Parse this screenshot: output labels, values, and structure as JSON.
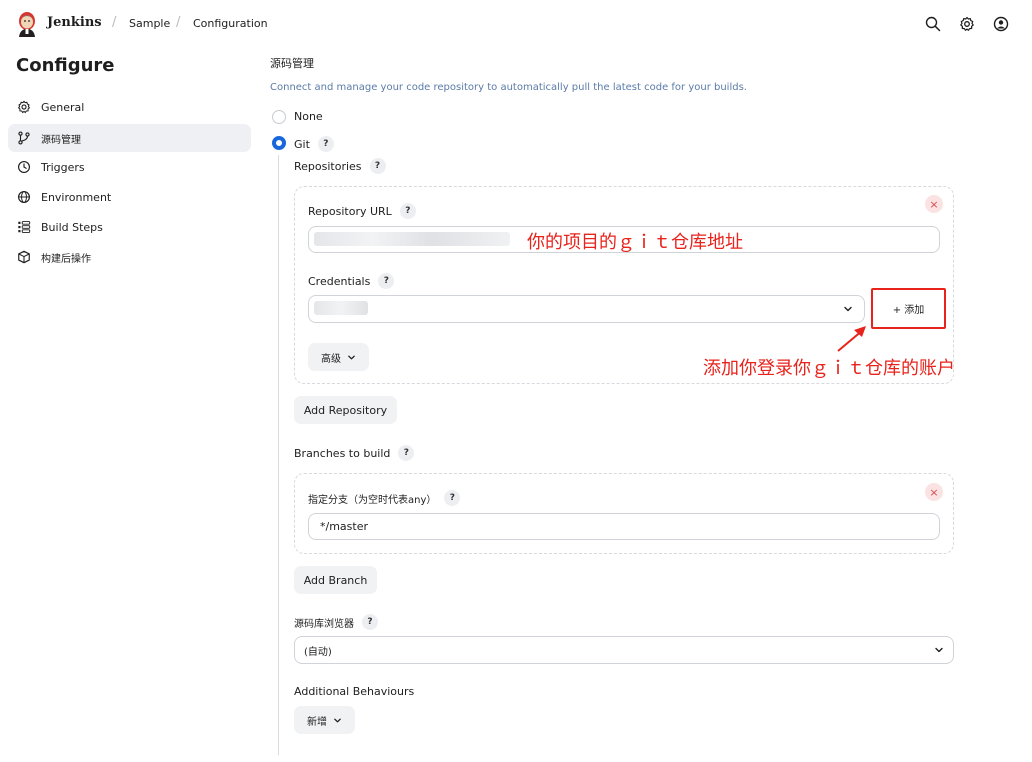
{
  "header": {
    "brand": "Jenkins",
    "breadcrumb": [
      "Sample",
      "Configuration"
    ],
    "separator": "/"
  },
  "sidebar": {
    "title": "Configure",
    "items": [
      {
        "label": "General",
        "icon": "gear-icon"
      },
      {
        "label": "源码管理",
        "icon": "branch-icon",
        "active": true
      },
      {
        "label": "Triggers",
        "icon": "clock-icon"
      },
      {
        "label": "Environment",
        "icon": "globe-icon"
      },
      {
        "label": "Build Steps",
        "icon": "list-icon"
      },
      {
        "label": "构建后操作",
        "icon": "cube-icon"
      }
    ]
  },
  "scm": {
    "title": "源码管理",
    "description": "Connect and manage your code repository to automatically pull the latest code for your builds.",
    "options": [
      {
        "label": "None",
        "selected": false
      },
      {
        "label": "Git",
        "selected": true
      }
    ],
    "repositories_label": "Repositories",
    "repository_url_label": "Repository URL",
    "repository_url_value": "",
    "credentials_label": "Credentials",
    "credentials_value": "",
    "add_button": "+ 添加",
    "advanced_button": "高级",
    "add_repository_button": "Add Repository",
    "branches_label": "Branches to build",
    "branch_specifier_label": "指定分支（为空时代表any）",
    "branch_specifier_value": "*/master",
    "add_branch_button": "Add Branch",
    "browser_label": "源码库浏览器",
    "browser_value": "(自动)",
    "additional_behaviours_label": "Additional Behaviours",
    "add_new_button": "新增",
    "help_glyph": "?",
    "remove_glyph": "×"
  },
  "annotations": {
    "url_note": "你的项目的ｇｉｔ仓库地址",
    "credentials_note": "添加你登录你ｇｉｔ仓库的账户"
  },
  "colors": {
    "accent": "#1868db",
    "annotation": "#e8231c"
  }
}
